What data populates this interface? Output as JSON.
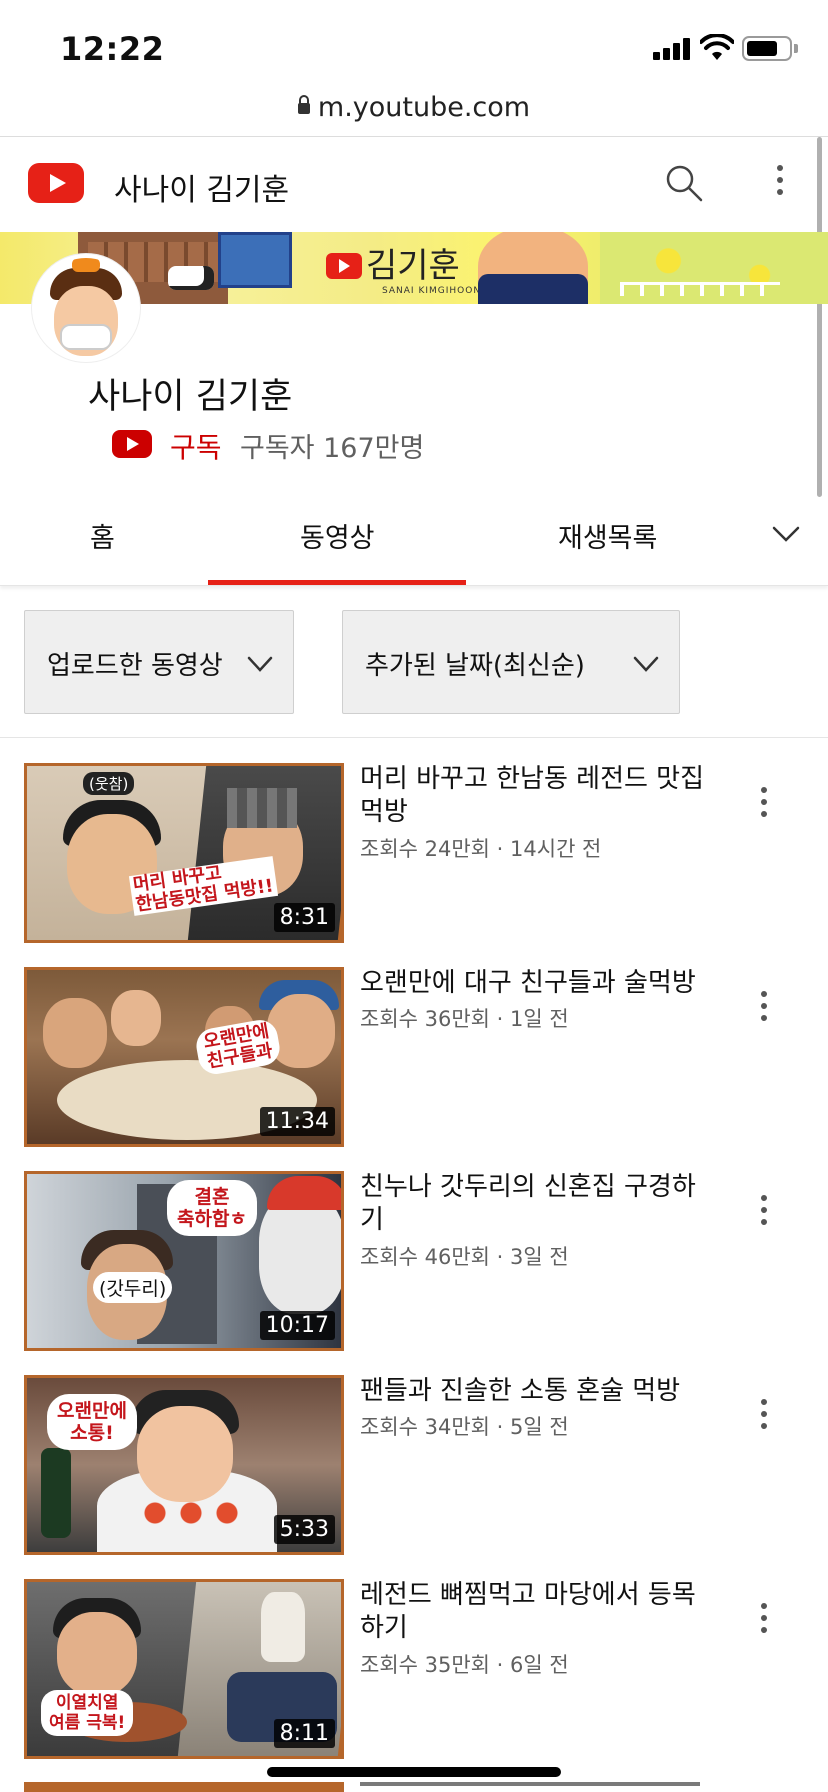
{
  "status_bar": {
    "time": "12:22",
    "battery_level": 0.75
  },
  "browser": {
    "url": "m.youtube.com"
  },
  "header": {
    "title": "사나이 김기훈"
  },
  "banner": {
    "logo_text": "김기훈",
    "sub_text": "SANAI KIMGIHOON"
  },
  "channel": {
    "name": "사나이 김기훈",
    "subscribe_label": "구독",
    "subscriber_count": "구독자 167만명"
  },
  "tabs": [
    {
      "label": "홈",
      "selected": false
    },
    {
      "label": "동영상",
      "selected": true
    },
    {
      "label": "재생목록",
      "selected": false
    }
  ],
  "filters": {
    "type": "업로드한 동영상",
    "sort": "추가된 날짜(최신순)"
  },
  "videos": [
    {
      "title": "머리 바꾸고 한남동 레전드 맛집 먹방",
      "meta": "조회수 24만회 · 14시간 전",
      "duration": "8:31",
      "thumb_text": "머리 바꾸고\n한남동맛집 먹방!!",
      "thumb_tag": "(웃참)"
    },
    {
      "title": "오랜만에 대구 친구들과 술먹방",
      "meta": "조회수 36만회 · 1일 전",
      "duration": "11:34",
      "thumb_text": "오랜만에\n친구들과"
    },
    {
      "title": "친누나 갓두리의 신혼집 구경하기",
      "meta": "조회수 46만회 · 3일 전",
      "duration": "10:17",
      "thumb_text": "결혼\n축하함ㅎ",
      "thumb_tag": "(갓두리)"
    },
    {
      "title": "팬들과 진솔한 소통 혼술 먹방",
      "meta": "조회수 34만회 · 5일 전",
      "duration": "5:33",
      "thumb_text": "오랜만에\n소통!"
    },
    {
      "title": "레전드 뼈찜먹고 마당에서 등목하기",
      "meta": "조회수 35만회 · 6일 전",
      "duration": "8:11",
      "thumb_text": "이열치열\n여름 극복!"
    }
  ]
}
